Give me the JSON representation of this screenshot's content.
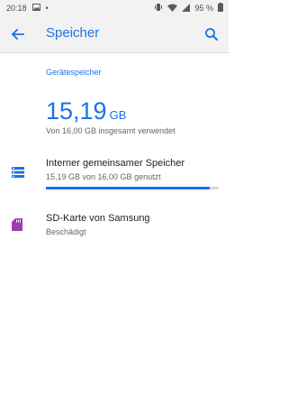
{
  "status_bar": {
    "time": "20:18",
    "dot": "•",
    "battery": "95 %",
    "icons": [
      "image-icon",
      "vibrate-icon",
      "wifi-icon",
      "signal-icon",
      "battery-icon"
    ]
  },
  "app_bar": {
    "title": "Speicher",
    "back_icon": "arrow-back-icon",
    "search_icon": "search-icon"
  },
  "device_storage": {
    "header": "Gerätespeicher",
    "used_value": "15,19",
    "used_unit": "GB",
    "summary": "Von 16,00 GB insgesamt verwendet"
  },
  "items": [
    {
      "title": "Interner gemeinsamer Speicher",
      "subtitle": "15,19 GB von 16,00 GB genutzt",
      "icon": "storage-list-icon",
      "progress_fraction": 0.949
    },
    {
      "title": "SD-Karte von Samsung",
      "subtitle": "Beschädigt",
      "icon": "sd-card-icon"
    }
  ],
  "colors": {
    "accent": "#1a73e8",
    "sd_icon": "#a13bb2",
    "progress_track": "#d8d8d8"
  }
}
